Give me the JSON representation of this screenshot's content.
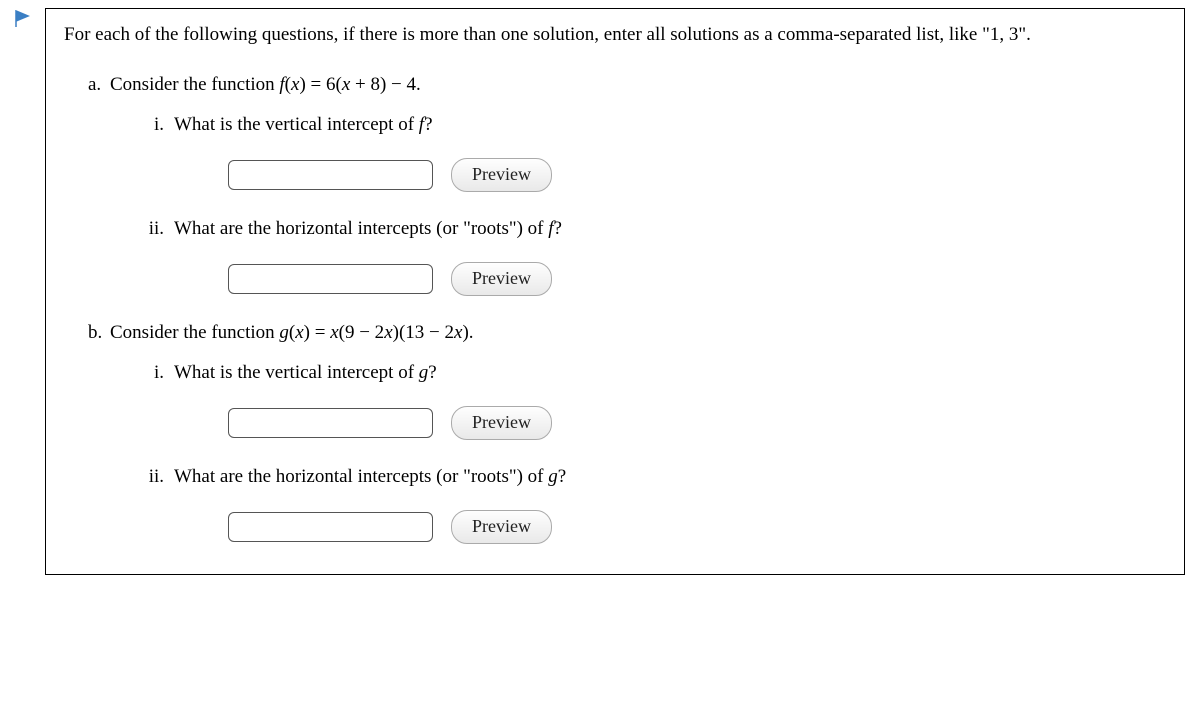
{
  "intro": "For each of the following questions, if there is more than one solution, enter all solutions as a comma-separated list, like \"1, 3\".",
  "parts": {
    "a": {
      "label": "a.",
      "prompt_pre": "Consider the function ",
      "fn": "f(x) = 6(x + 8) − 4.",
      "sub": {
        "i": {
          "label": "i.",
          "text_pre": "What is the vertical intercept of ",
          "fn": "f",
          "text_post": "?"
        },
        "ii": {
          "label": "ii.",
          "text_pre": "What are the horizontal intercepts (or \"roots\") of ",
          "fn": "f",
          "text_post": "?"
        }
      }
    },
    "b": {
      "label": "b.",
      "prompt_pre": "Consider the function ",
      "fn": "g(x) = x(9 − 2x)(13 − 2x).",
      "sub": {
        "i": {
          "label": "i.",
          "text_pre": "What is the vertical intercept of ",
          "fn": "g",
          "text_post": "?"
        },
        "ii": {
          "label": "ii.",
          "text_pre": "What are the horizontal intercepts (or \"roots\") of ",
          "fn": "g",
          "text_post": "?"
        }
      }
    }
  },
  "buttons": {
    "preview": "Preview"
  }
}
